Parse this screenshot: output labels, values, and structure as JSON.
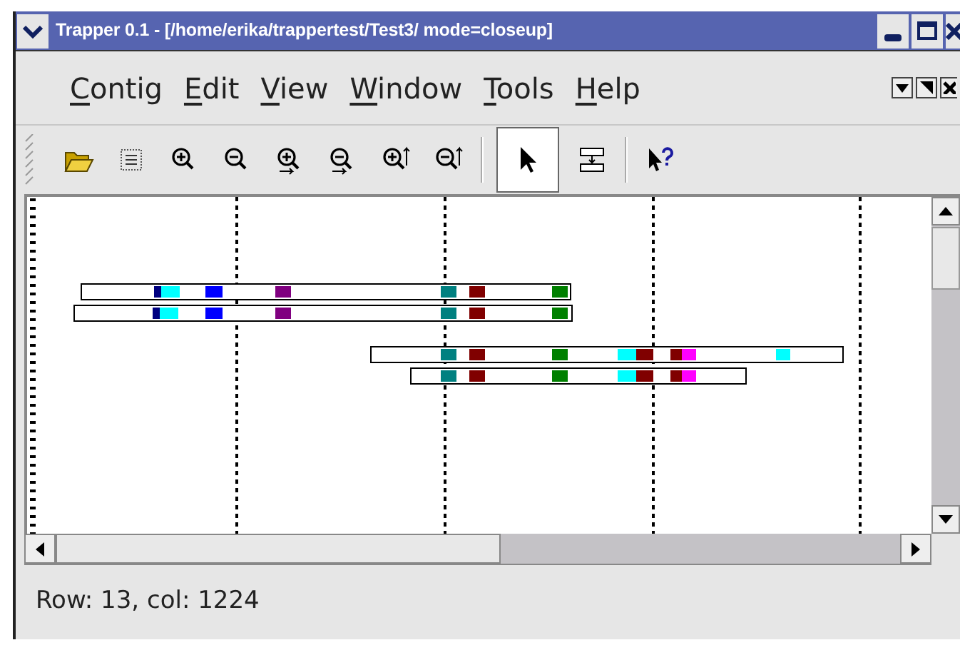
{
  "window": {
    "title": "Trapper 0.1 - [/home/erika/trappertest/Test3/ mode=closeup]"
  },
  "menu": [
    {
      "underlined": "C",
      "rest": "ontig"
    },
    {
      "underlined": "E",
      "rest": "dit"
    },
    {
      "underlined": "V",
      "rest": "iew"
    },
    {
      "underlined": "W",
      "rest": "indow"
    },
    {
      "underlined": "T",
      "rest": "ools"
    },
    {
      "underlined": "H",
      "rest": "elp"
    }
  ],
  "toolbar": [
    {
      "kind": "open"
    },
    {
      "kind": "list"
    },
    {
      "kind": "zoom-in"
    },
    {
      "kind": "zoom-out"
    },
    {
      "kind": "zoom-in-h"
    },
    {
      "kind": "zoom-out-h"
    },
    {
      "kind": "zoom-in-v"
    },
    {
      "kind": "zoom-out-v"
    },
    {
      "kind": "separator"
    },
    {
      "kind": "pointer",
      "selected": true
    },
    {
      "kind": "move",
      "selected": false
    },
    {
      "kind": "separator"
    },
    {
      "kind": "help"
    }
  ],
  "status_bar": "Row: 13, col: 1224"
}
